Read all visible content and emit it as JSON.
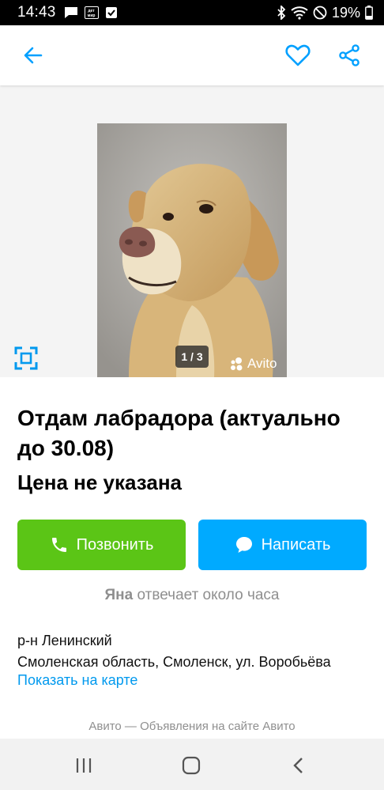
{
  "status_bar": {
    "time": "14:43",
    "detmir_label": "дет мир",
    "battery": "19%"
  },
  "app_bar": {
    "icons": [
      "arrow-left-icon",
      "heart-icon",
      "share-icon"
    ],
    "accent_color": "#00a0ff"
  },
  "gallery": {
    "counter": "1 / 3",
    "watermark": "Avito",
    "photo_subject": "labrador-dog-photo"
  },
  "listing": {
    "title": "Отдам лабрадора (актуально до 30.08)",
    "price": "Цена не указана"
  },
  "actions": {
    "call_label": "Позвонить",
    "call_color": "#5bc516",
    "write_label": "Написать",
    "write_color": "#00aaff"
  },
  "seller": {
    "name": "Яна",
    "response": "отвечает около часа"
  },
  "location": {
    "district": "р-н Ленинский",
    "address": "Смоленская область, Смоленск, ул. Воробьёва",
    "map_link": "Показать на карте"
  },
  "footer": {
    "text": "Авито — Объявления на сайте Авито"
  }
}
